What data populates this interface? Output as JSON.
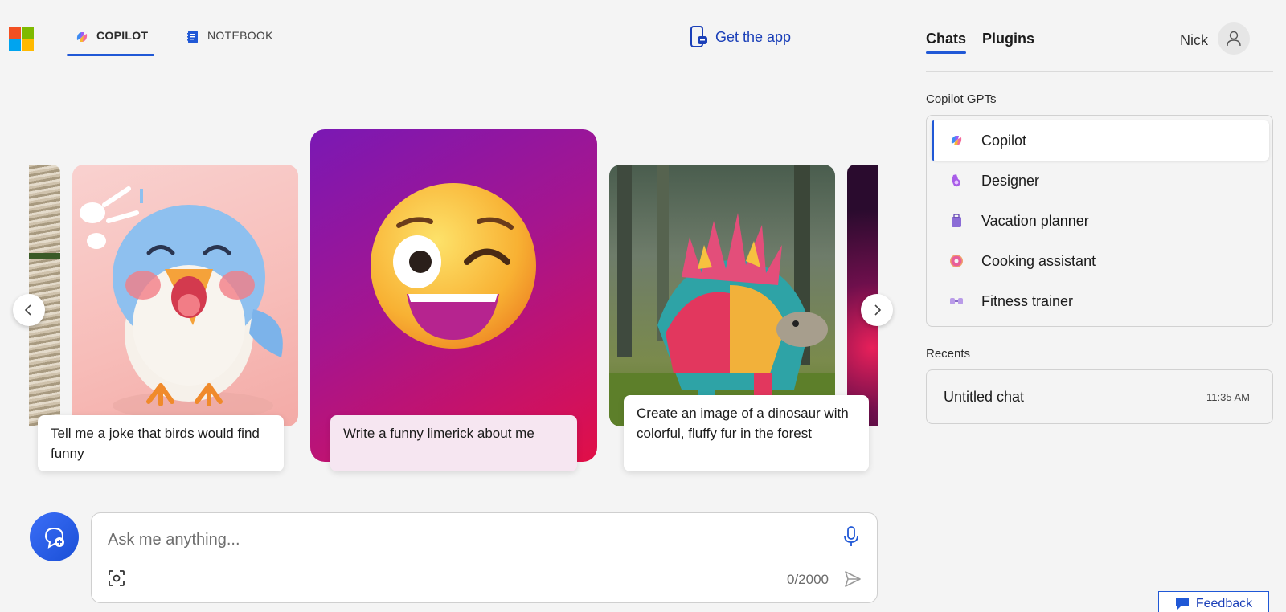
{
  "header": {
    "logo_icon": "microsoft-logo",
    "tabs": [
      {
        "label": "COPILOT",
        "icon": "copilot-icon",
        "active": true
      },
      {
        "label": "NOTEBOOK",
        "icon": "notebook-icon",
        "active": false
      }
    ],
    "get_app": {
      "label": "Get the app",
      "icon": "phone-chat-icon"
    }
  },
  "carousel": {
    "cards": [
      {
        "caption": "Tell me a joke that birds would find funny",
        "image": "laughing-bird"
      },
      {
        "caption": "Write a funny limerick about me",
        "image": "winking-emoji"
      },
      {
        "caption": "Create an image of a dinosaur with colorful, fluffy fur in the forest",
        "image": "fluffy-dinosaur"
      }
    ],
    "prev_icon": "chevron-left-icon",
    "next_icon": "chevron-right-icon"
  },
  "compose": {
    "placeholder": "Ask me anything...",
    "counter": "0/2000",
    "new_topic_icon": "new-topic-icon",
    "mic_icon": "microphone-icon",
    "screenshot_icon": "image-capture-icon",
    "send_icon": "send-icon"
  },
  "right_pane": {
    "tabs": [
      {
        "label": "Chats",
        "active": true
      },
      {
        "label": "Plugins",
        "active": false
      }
    ],
    "user_name": "Nick",
    "gpts_label": "Copilot GPTs",
    "gpts": [
      {
        "label": "Copilot",
        "icon": "copilot-icon",
        "selected": true
      },
      {
        "label": "Designer",
        "icon": "designer-icon",
        "selected": false
      },
      {
        "label": "Vacation planner",
        "icon": "suitcase-icon",
        "selected": false
      },
      {
        "label": "Cooking assistant",
        "icon": "donut-icon",
        "selected": false
      },
      {
        "label": "Fitness trainer",
        "icon": "dumbbell-icon",
        "selected": false
      }
    ],
    "recents_label": "Recents",
    "recents": [
      {
        "title": "Untitled chat",
        "time": "11:35 AM"
      }
    ]
  },
  "feedback": {
    "label": "Feedback",
    "icon": "feedback-icon"
  },
  "colors": {
    "accent": "#2058d6",
    "link": "#1a3fb8"
  }
}
